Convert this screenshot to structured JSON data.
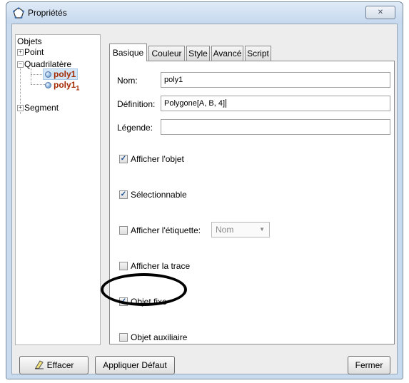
{
  "window": {
    "title": "Propriétés"
  },
  "tree": {
    "root": "Objets",
    "nodes": [
      "Point",
      "Quadrilatère",
      "Segment"
    ],
    "items": [
      {
        "name": "poly1",
        "subscript": ""
      },
      {
        "name": "poly1",
        "subscript": "1"
      }
    ]
  },
  "tabs": [
    "Basique",
    "Couleur",
    "Style",
    "Avancé",
    "Script"
  ],
  "basic": {
    "name_label": "Nom:",
    "name_value": "poly1",
    "definition_label": "Définition:",
    "definition_value": "Polygone[A, B, 4]",
    "caption_label": "Légende:",
    "caption_value": ""
  },
  "checkboxes": [
    {
      "label": "Afficher l'objet",
      "checked": true
    },
    {
      "label": "Sélectionnable",
      "checked": true
    },
    {
      "label": "Afficher l'étiquette:",
      "checked": false
    },
    {
      "label": "Afficher la trace",
      "checked": false
    },
    {
      "label": "Objet fixe",
      "checked": true
    },
    {
      "label": "Objet auxiliaire",
      "checked": false
    }
  ],
  "label_dropdown": {
    "selected": "Nom"
  },
  "buttons": {
    "delete": "Effacer",
    "apply_default": "Appliquer Défaut",
    "close": "Fermer"
  }
}
